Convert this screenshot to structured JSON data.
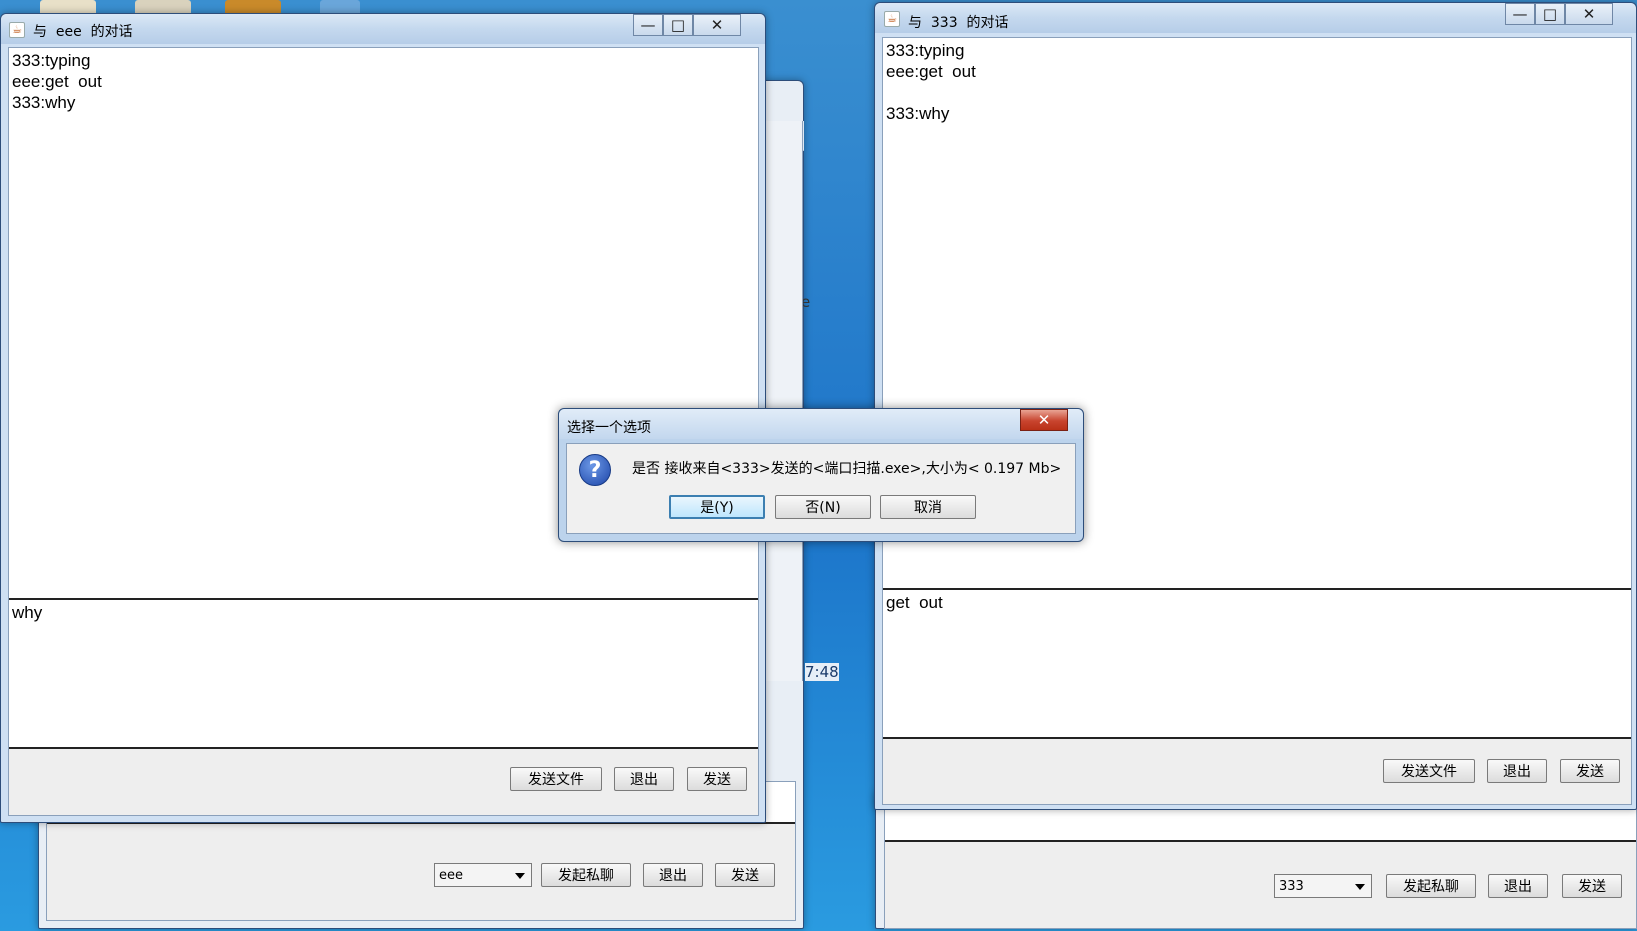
{
  "left_chat": {
    "title": "与  eee  的对话",
    "history": "333:typing\neee:get  out\n333:why",
    "input": "why",
    "buttons": {
      "send_file": "发送文件",
      "exit": "退出",
      "send": "发送"
    }
  },
  "right_chat": {
    "title": "与  333  的对话",
    "history": "333:typing\neee:get  out\n\n333:why",
    "input": "get  out",
    "buttons": {
      "send_file": "发送文件",
      "exit": "退出",
      "send": "发送"
    }
  },
  "left_main": {
    "user_select": "eee",
    "buttons": {
      "private_chat": "发起私聊",
      "exit": "退出",
      "send": "发送"
    },
    "time_fragment": "7:48",
    "text_fragment": "e"
  },
  "right_main": {
    "user_select": "333",
    "buttons": {
      "private_chat": "发起私聊",
      "exit": "退出",
      "send": "发送"
    }
  },
  "dialog": {
    "title": "选择一个选项",
    "message": "是否 接收来自<333>发送的<端口扫描.exe>,大小为< 0.197 Mb>",
    "buttons": {
      "yes": "是(Y)",
      "no": "否(N)",
      "cancel": "取消"
    }
  },
  "window_controls": {
    "minimize": "—",
    "maximize": "□",
    "close": "✕"
  },
  "colors": {
    "titlebar": "#c4d8ee",
    "desktop": "#1c74c9",
    "close_red": "#c8442e"
  }
}
